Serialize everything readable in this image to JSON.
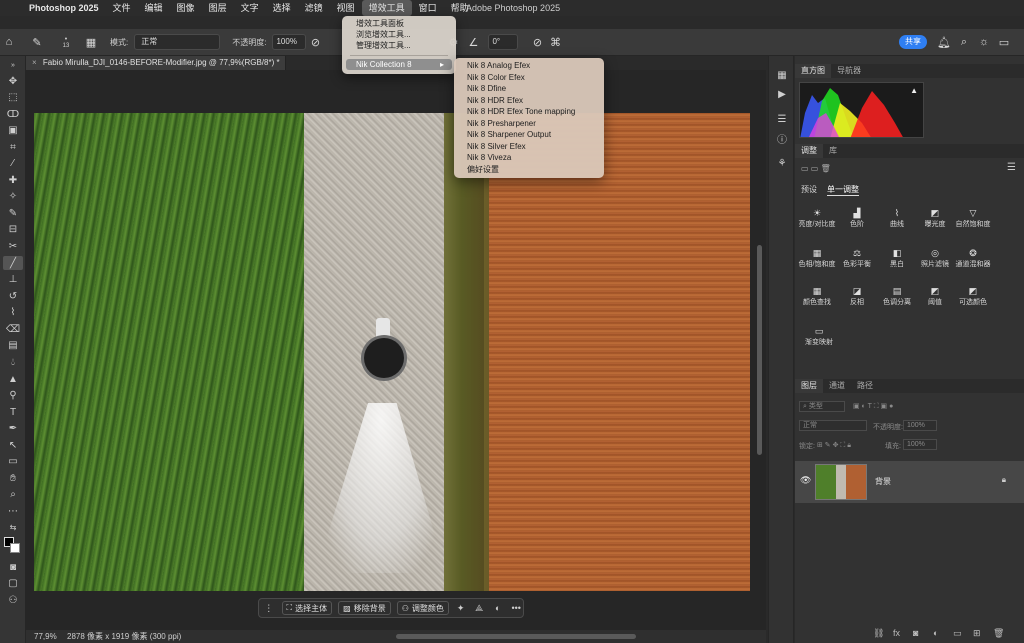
{
  "menubar": {
    "app": "Photoshop 2025",
    "items": [
      "文件",
      "编辑",
      "图像",
      "图层",
      "文字",
      "选择",
      "滤镜",
      "视图",
      "增效工具",
      "窗口",
      "帮助"
    ],
    "active": "增效工具",
    "window_title": "Adobe Photoshop 2025"
  },
  "options": {
    "brush_size": "13",
    "mode_label": "模式:",
    "mode_value": "正常",
    "opacity_label": "不透明度:",
    "opacity_value": "100%",
    "angle_value": "0°",
    "share_label": "共享"
  },
  "document": {
    "tab_title": "Fabio Mirulla_DJI_0146-BEFORE-Modifier.jpg @ 77,9%(RGB/8*) *"
  },
  "plugins_menu": {
    "items": [
      "增效工具面板",
      "浏览增效工具...",
      "管理增效工具..."
    ],
    "highlighted": "Nik Collection 8"
  },
  "nik_menu": {
    "items": [
      "Nik 8 Analog Efex",
      "Nik 8 Color Efex",
      "Nik 8 Dfine",
      "Nik 8 HDR Efex",
      "Nik 8 HDR Efex Tone mapping",
      "Nik 8 Presharpener",
      "Nik 8 Sharpener Output",
      "Nik 8 Silver Efex",
      "Nik 8 Viveza",
      "偏好设置"
    ]
  },
  "taskbar": {
    "select_subject": "选择主体",
    "remove_bg": "移除背景",
    "adjust_color": "调整颜色"
  },
  "status": {
    "zoom": "77,9%",
    "info": "2878 像素 x 1919 像素 (300 ppi)"
  },
  "panels": {
    "histogram_tabs": [
      "直方图",
      "导航器"
    ],
    "adjust_tabs": [
      "调整",
      "库"
    ],
    "adjust_subtabs": [
      "预设",
      "单一调整"
    ],
    "adjustments": [
      "亮度/对比度",
      "色阶",
      "曲线",
      "曝光度",
      "自然饱和度",
      "色相/饱和度",
      "色彩平衡",
      "黑白",
      "照片滤镜",
      "通道混和器",
      "颜色查找",
      "反相",
      "色调分离",
      "阈值",
      "可选颜色",
      "渐变映射"
    ],
    "layers_tabs": [
      "图层",
      "通道",
      "路径"
    ],
    "layer_kind": "类型",
    "blend_mode": "正常",
    "opacity_label": "不透明度:",
    "opacity_value": "100%",
    "lock_label": "锁定:",
    "fill_label": "填充:",
    "fill_value": "100%",
    "layer_name": "背景"
  }
}
